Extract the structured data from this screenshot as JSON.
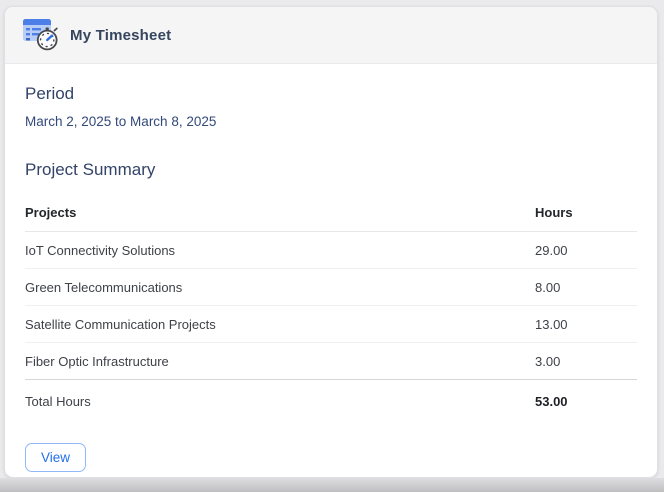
{
  "card": {
    "title": "My Timesheet",
    "icon": "timesheet-clock-icon"
  },
  "period": {
    "heading": "Period",
    "value": "March 2, 2025 to March 8, 2025"
  },
  "summary": {
    "heading": "Project Summary",
    "columns": {
      "projects": "Projects",
      "hours": "Hours"
    },
    "rows": [
      {
        "project": "IoT Connectivity Solutions",
        "hours": "29.00"
      },
      {
        "project": "Green Telecommunications",
        "hours": "8.00"
      },
      {
        "project": "Satellite Communication Projects",
        "hours": "13.00"
      },
      {
        "project": "Fiber Optic Infrastructure",
        "hours": "3.00"
      }
    ],
    "total": {
      "label": "Total Hours",
      "hours": "53.00"
    }
  },
  "actions": {
    "view_label": "View"
  },
  "colors": {
    "accent_blue": "#2370e8",
    "button_border": "#91b8f7",
    "title_navy": "#36455e",
    "heading_navy": "#334468",
    "date_navy": "#33497a",
    "row_text": "#3e4248",
    "table_header_text": "#23262b",
    "card_border": "#dfe0e2",
    "header_bg": "#f5f5f6",
    "page_bg": "#eaeaec",
    "icon_blue": "#4c80e8",
    "icon_light_blue": "#b9cef6"
  }
}
